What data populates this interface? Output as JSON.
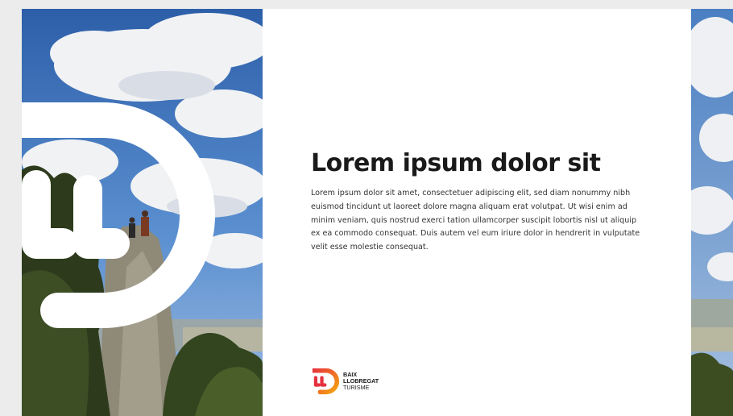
{
  "content": {
    "heading": "Lorem ipsum dolor sit",
    "paragraph": "Lorem ipsum dolor sit amet, consectetuer adipiscing elit, sed diam nonummy nibh euismod tincidunt ut laoreet dolore magna aliquam erat volutpat. Ut wisi enim ad minim veniam, quis nostrud exerci tation ullamcorper suscipit lobortis nisl ut aliquip ex ea commodo consequat. Duis autem vel eum iriure dolor in hendrerit in vulputate velit esse molestie consequat."
  },
  "brand": {
    "mark_letters": "LL",
    "line1": "BAIX",
    "line2": "LLOBREGAT",
    "line3": "TURISME"
  },
  "colors": {
    "brand_gradient": [
      "#e6313f",
      "#f28b1e",
      "#f6b40e"
    ],
    "sky": "#3f78c0",
    "cloud": "#f2f3f5",
    "foliage": "#2f3d1e"
  },
  "icons": {
    "watermark": "ll-logo-watermark-icon",
    "brand_mark": "ll-brand-mark-icon"
  }
}
